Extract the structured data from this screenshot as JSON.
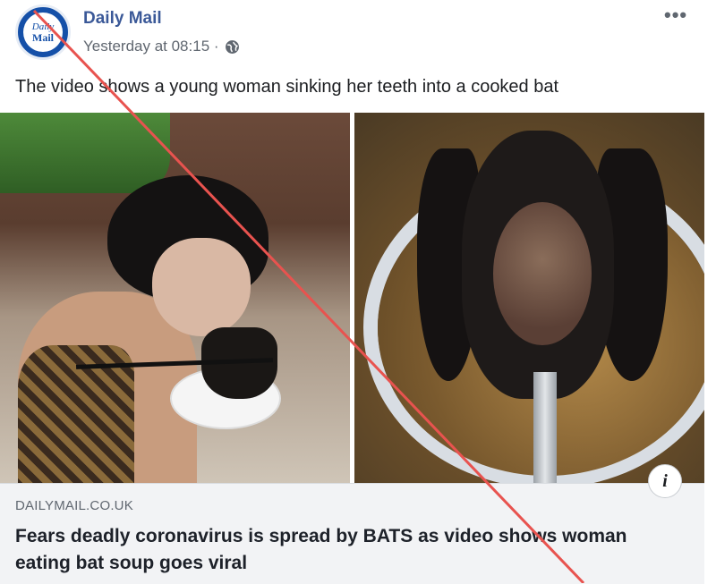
{
  "post": {
    "page_name": "Daily Mail",
    "avatar": {
      "line1": "Daily",
      "line2": "Mail"
    },
    "timestamp": "Yesterday at 08:15 ·",
    "audience_icon": "globe-icon",
    "more_icon": "more-options-icon",
    "more_label": "•••",
    "caption": "The video shows a young woman sinking her teeth into a cooked bat"
  },
  "link": {
    "domain": "DAILYMAIL.CO.UK",
    "headline": "Fears deadly coronavirus is spread by BATS as video shows woman eating bat soup goes viral",
    "info_label": "i"
  },
  "colors": {
    "page_name": "#3b5998",
    "strike_line": "#e8534f",
    "link_background": "#f2f3f5"
  }
}
